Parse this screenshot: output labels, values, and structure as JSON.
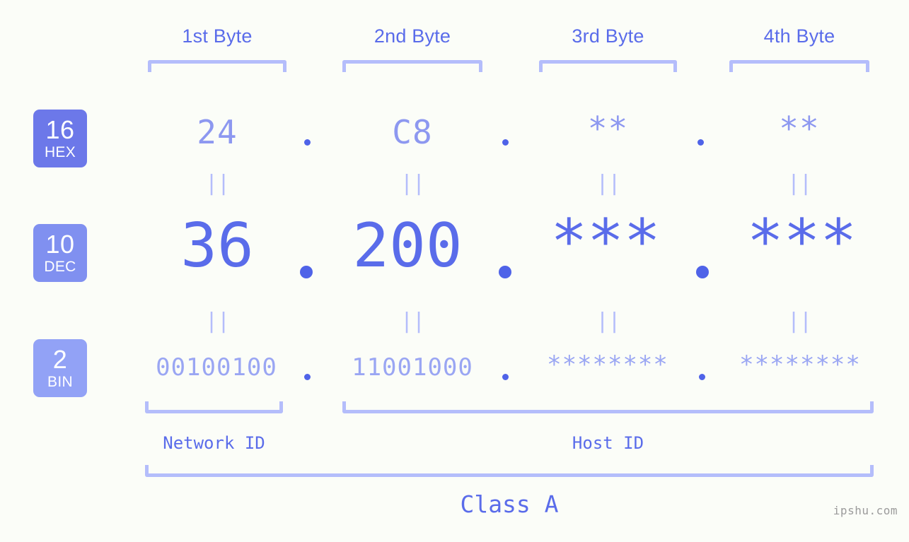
{
  "meta": {
    "watermark": "ipshu.com",
    "background_color": "#fbfdf8",
    "accent_color": "#5a6cea",
    "bracket_color": "#b4bdfb"
  },
  "byte_headers": [
    {
      "label": "1st Byte"
    },
    {
      "label": "2nd Byte"
    },
    {
      "label": "3rd Byte"
    },
    {
      "label": "4th Byte"
    }
  ],
  "rows": [
    {
      "badge_number": "16",
      "badge_name": "HEX",
      "badge_color": "#6c78e9",
      "values": [
        "24",
        "C8",
        "**",
        "**"
      ],
      "separator": "."
    },
    {
      "badge_number": "10",
      "badge_name": "DEC",
      "badge_color": "#8090f0",
      "values": [
        "36",
        "200",
        "***",
        "***"
      ],
      "separator": "."
    },
    {
      "badge_number": "2",
      "badge_name": "BIN",
      "badge_color": "#92a2f6",
      "values": [
        "00100100",
        "11001000",
        "********",
        "********"
      ],
      "separator": "."
    }
  ],
  "equals": {
    "glyph": "||"
  },
  "segments": {
    "network_id": "Network ID",
    "host_id": "Host ID",
    "class": "Class A"
  }
}
